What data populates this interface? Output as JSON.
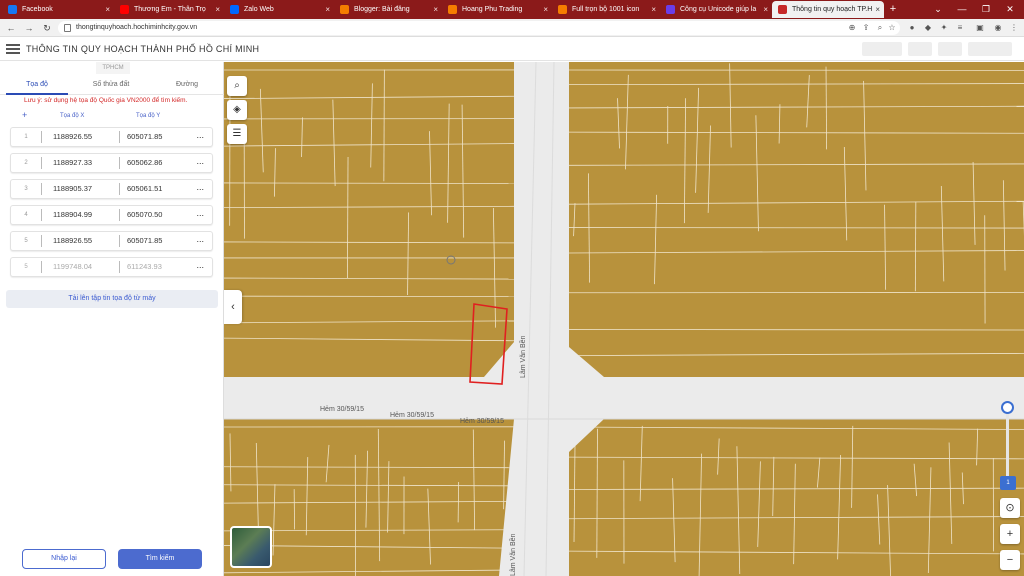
{
  "browser": {
    "tabs": [
      {
        "title": "Facebook",
        "color": "#1877f2"
      },
      {
        "title": "Thương Em - Thân Trọ",
        "color": "#ff0000"
      },
      {
        "title": "Zalo Web",
        "color": "#0068ff"
      },
      {
        "title": "Blogger: Bài đăng",
        "color": "#f57d00"
      },
      {
        "title": "Hoang Phu Trading",
        "color": "#f57d00"
      },
      {
        "title": "Full trọn bộ 1001 icon",
        "color": "#f57d00"
      },
      {
        "title": "Công cụ Unicode giúp la",
        "color": "#6a3de8"
      },
      {
        "title": "Thông tin quy hoạch TP.H",
        "color": "#c62828"
      }
    ],
    "tab_close": "×",
    "new_tab": "+",
    "url": "thongtinquyhoach.hochiminhcity.gov.vn"
  },
  "header": {
    "title": "THÔNG TIN QUY HOẠCH THÀNH PHỐ HỒ CHÍ MINH"
  },
  "panel": {
    "logo": "TPHCM",
    "tabs": [
      "Tọa độ",
      "Số thửa đất",
      "Đường"
    ],
    "note": "Lưu ý: sử dụng hệ tọa độ Quốc gia VN2000 để tìm kiếm.",
    "add": "+",
    "col_x": "Tọa độ X",
    "col_y": "Tọa độ Y",
    "rows": [
      {
        "n": "1",
        "x": "1188926.55",
        "y": "605071.85"
      },
      {
        "n": "2",
        "x": "1188927.33",
        "y": "605062.86"
      },
      {
        "n": "3",
        "x": "1188905.37",
        "y": "605061.51"
      },
      {
        "n": "4",
        "x": "1188904.99",
        "y": "605070.50"
      },
      {
        "n": "5",
        "x": "1188926.55",
        "y": "605071.85"
      },
      {
        "n": "5",
        "x": "1199748.04",
        "y": "611243.93"
      }
    ],
    "more": "...",
    "upload": "Tải lên tập tin tọa độ từ máy",
    "reset": "Nhập lại",
    "search": "Tìm kiếm"
  },
  "map": {
    "streets": [
      "Hẻm 30/59/15",
      "Hẻm 30/59/15",
      "Hẻm 30/59/15",
      "Lâm Văn Bền",
      "Lâm Văn Bền"
    ],
    "zoom_level": "1",
    "collapse": "‹",
    "zoom_in": "+",
    "zoom_out": "−",
    "locate": "⊙"
  }
}
